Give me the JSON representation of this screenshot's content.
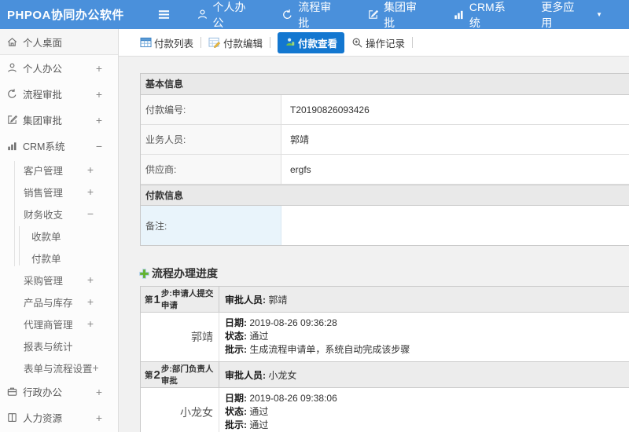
{
  "colors": {
    "header_blue": "#4a90db",
    "active_tab_blue": "#1377d0",
    "plus_green": "#63b32e",
    "note_label_bg": "#e9f4fb"
  },
  "header": {
    "logo": "PHPOA协同办公软件",
    "nav": [
      {
        "label": "个人办公",
        "icon": "user-icon"
      },
      {
        "label": "流程审批",
        "icon": "process-icon"
      },
      {
        "label": "集团审批",
        "icon": "edit-icon"
      },
      {
        "label": "CRM系统",
        "icon": "chart-icon"
      },
      {
        "label": "更多应用",
        "icon": "caret-down-icon"
      }
    ]
  },
  "sidebar": {
    "items": [
      {
        "label": "个人桌面",
        "icon": "home-icon",
        "expander": ""
      },
      {
        "label": "个人办公",
        "icon": "user-icon",
        "expander": "+"
      },
      {
        "label": "流程审批",
        "icon": "process-icon",
        "expander": "+"
      },
      {
        "label": "集团审批",
        "icon": "edit-icon",
        "expander": "+"
      },
      {
        "label": "CRM系统",
        "icon": "chart-icon",
        "expander": "−"
      },
      {
        "label": "客户管理",
        "expander": "+"
      },
      {
        "label": "销售管理",
        "expander": "+"
      },
      {
        "label": "财务收支",
        "expander": "−"
      },
      {
        "label": "收款单",
        "expander": ""
      },
      {
        "label": "付款单",
        "expander": ""
      },
      {
        "label": "采购管理",
        "expander": "+"
      },
      {
        "label": "产品与库存",
        "expander": "+"
      },
      {
        "label": "代理商管理",
        "expander": "+"
      },
      {
        "label": "报表与统计",
        "expander": ""
      },
      {
        "label": "表单与流程设置",
        "expander": "+"
      },
      {
        "label": "行政办公",
        "icon": "briefcase-icon",
        "expander": "+"
      },
      {
        "label": "人力资源",
        "icon": "book-icon",
        "expander": "+"
      }
    ]
  },
  "tabs": [
    {
      "label": "付款列表",
      "icon": "table-icon",
      "active": false
    },
    {
      "label": "付款编辑",
      "icon": "edit-table-icon",
      "active": false
    },
    {
      "label": "付款查看",
      "icon": "person-icon",
      "active": true
    },
    {
      "label": "操作记录",
      "icon": "zoom-plus-icon",
      "active": false
    }
  ],
  "basic_info": {
    "section_title": "基本信息",
    "rows": [
      {
        "label": "付款编号:",
        "value": "T20190826093426"
      },
      {
        "label": "业务人员:",
        "value": "郭靖"
      },
      {
        "label": "供应商:",
        "value": "ergfs"
      }
    ]
  },
  "payment_info": {
    "section_title": "付款信息",
    "note_label": "备注:",
    "note_value": ""
  },
  "process": {
    "heading": "流程办理进度",
    "labels": {
      "approver": "审批人员:",
      "date": "日期:",
      "status": "状态:",
      "comment": "批示:"
    },
    "steps": [
      {
        "step_pre": "第",
        "step_num": "1",
        "step_post": "步:申请人提交申请",
        "approver": "郭靖",
        "name": "郭靖",
        "date": "2019-08-26 09:36:28",
        "status": "通过",
        "comment": "生成流程申请单，系统自动完成该步骤"
      },
      {
        "step_pre": "第",
        "step_num": "2",
        "step_post": "步:部门负责人审批",
        "approver": "小龙女",
        "name": "小龙女",
        "date": "2019-08-26 09:38:06",
        "status": "通过",
        "comment": "通过"
      }
    ]
  }
}
